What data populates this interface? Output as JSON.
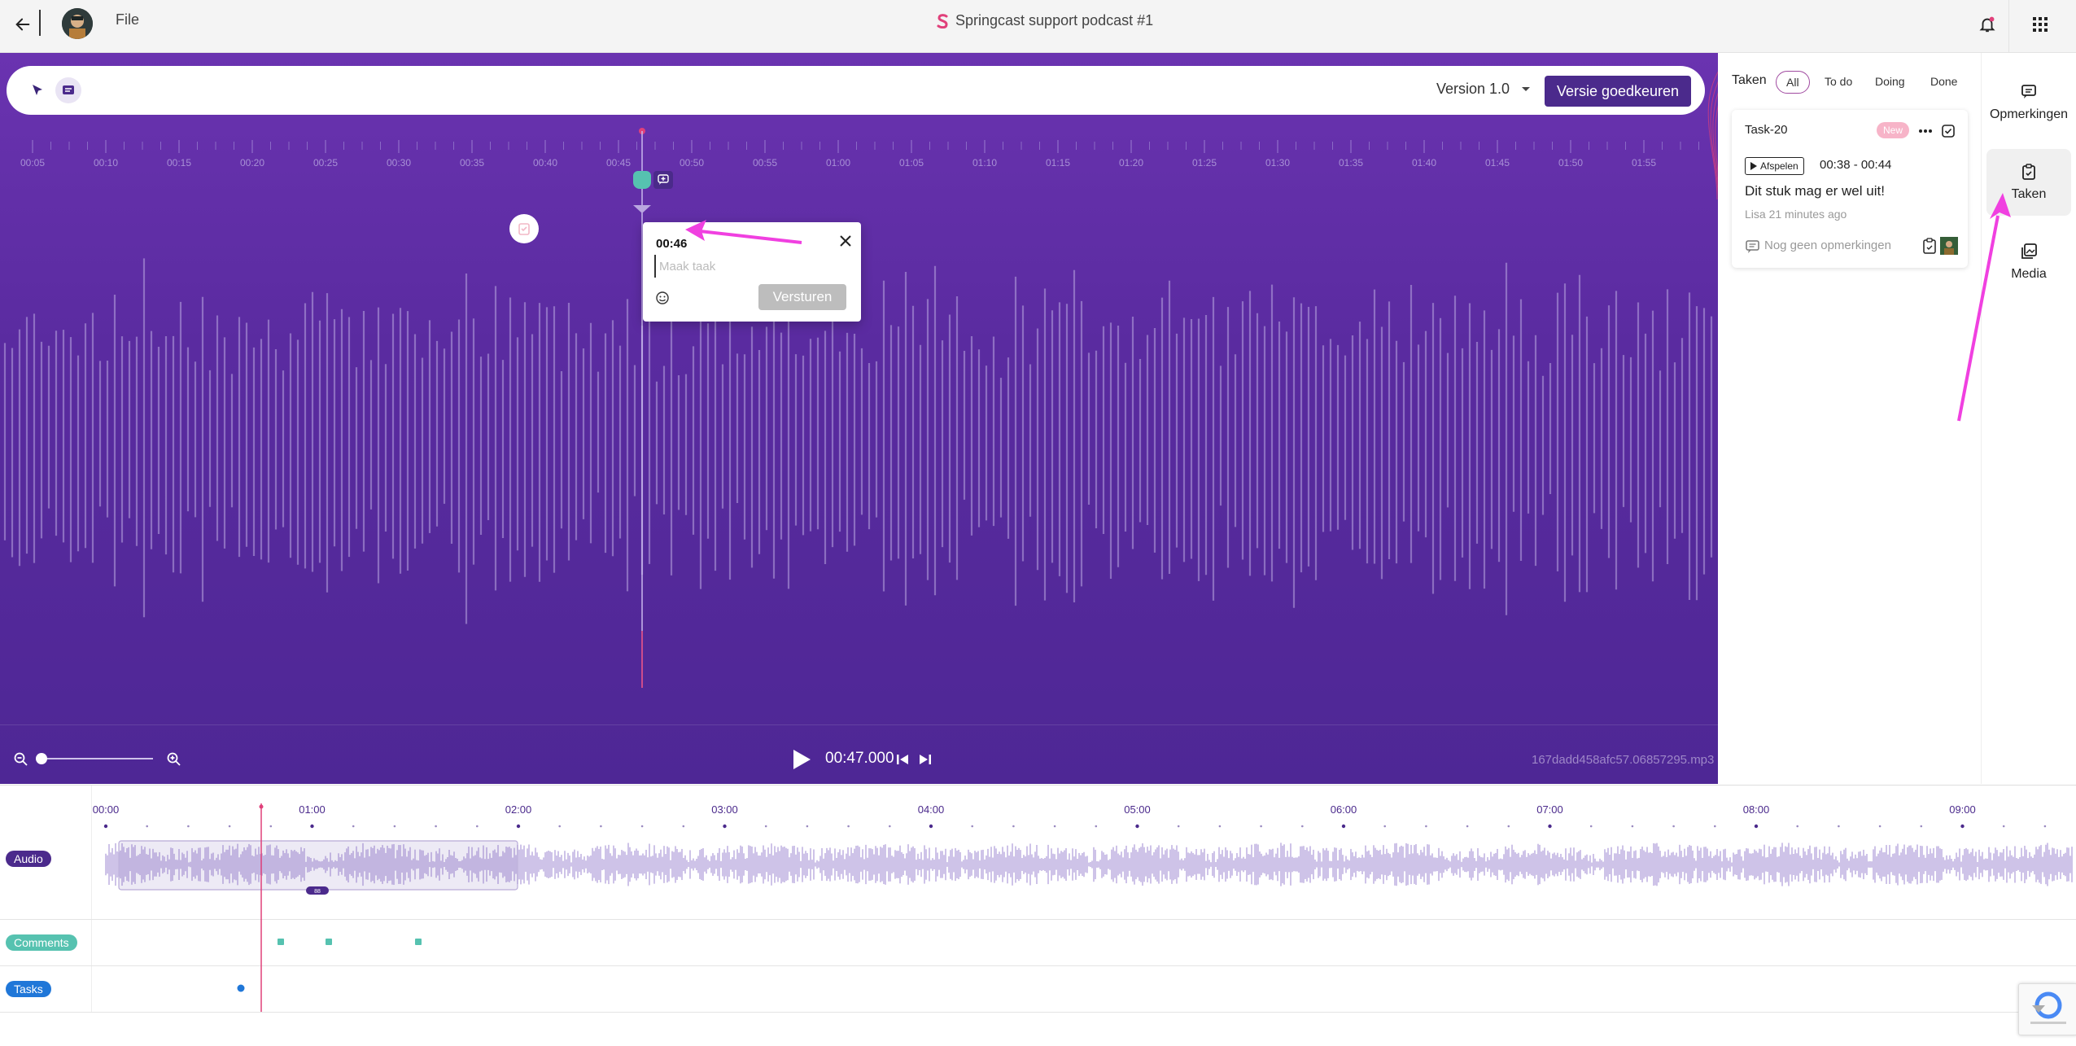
{
  "topbar": {
    "file_label": "File",
    "title": "Springcast support podcast #1",
    "app_logo_icon": "springcast-s-icon"
  },
  "editor": {
    "version_label": "Version 1.0",
    "approve_label": "Versie goedkeuren",
    "ruler_labels": [
      "00:05",
      "00:10",
      "00:15",
      "00:20",
      "00:25",
      "00:30",
      "00:35",
      "00:40",
      "00:45",
      "00:50",
      "00:55",
      "01:00",
      "01:05",
      "01:10",
      "01:15",
      "01:20",
      "01:25",
      "01:30",
      "01:35",
      "01:40",
      "01:45",
      "01:50",
      "01:55"
    ],
    "popup": {
      "time": "00:46",
      "placeholder": "Maak taak",
      "send_label": "Versturen"
    },
    "player": {
      "time": "00:47.000",
      "filename": "167dadd458afc57.06857295.mp3"
    }
  },
  "tasks_panel": {
    "title": "Taken",
    "filters": [
      "All",
      "To do",
      "Doing",
      "Done"
    ],
    "active_filter": "All",
    "task": {
      "id": "Task-20",
      "badge": "New",
      "play_label": "Afspelen",
      "range": "00:38 - 00:44",
      "text": "Dit stuk mag er wel uit!",
      "meta": "Lisa 21 minutes ago",
      "comments": "Nog geen opmerkingen"
    }
  },
  "side_nav": {
    "comments_label": "Opmerkingen",
    "tasks_label": "Taken",
    "media_label": "Media"
  },
  "timeline": {
    "labels": {
      "audio": "Audio",
      "comments": "Comments",
      "tasks": "Tasks"
    },
    "ticks": [
      "00:00",
      "01:00",
      "02:00",
      "03:00",
      "04:00",
      "05:00",
      "06:00",
      "07:00",
      "08:00",
      "09:00"
    ],
    "region_handle": "88",
    "colors": {
      "audio": "#4b2a8c",
      "comments": "#56c2b0",
      "tasks": "#2077d8",
      "playhead": "#e0407a"
    }
  }
}
